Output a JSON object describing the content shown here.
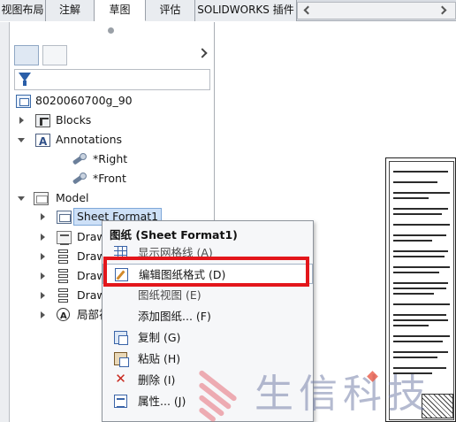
{
  "tabs": [
    {
      "label": "视图布局"
    },
    {
      "label": "注解"
    },
    {
      "label": "草图",
      "active": true
    },
    {
      "label": "评估"
    },
    {
      "label": "SOLIDWORKS 插件"
    }
  ],
  "tree": {
    "root": "8020060700g_90",
    "blocks": "Blocks",
    "annotations": "Annotations",
    "views": [
      "*Right",
      "*Front"
    ],
    "model": "Model",
    "sheet_format": "Sheet Format1",
    "drawings": [
      "Drawi",
      "Drawi",
      "Drawi",
      "Draw"
    ],
    "detail": "局部视"
  },
  "context_menu": {
    "title": "图纸 (Sheet Format1)",
    "items": [
      {
        "label": "显示网格线 (A)",
        "icon": "grid-icon"
      },
      {
        "label": "编辑图纸格式 (D)",
        "icon": "edit-sheet-format-icon",
        "highlighted": true
      },
      {
        "label": "图纸视图 (E)",
        "icon": ""
      },
      {
        "label": "添加图纸... (F)",
        "icon": ""
      },
      {
        "label": "复制 (G)",
        "icon": "copy-icon"
      },
      {
        "label": "粘贴 (H)",
        "icon": "paste-icon"
      },
      {
        "label": "删除 (I)",
        "icon": "delete-icon"
      },
      {
        "label": "属性... (J)",
        "icon": "properties-icon"
      }
    ]
  },
  "watermark": {
    "text": "生信科技"
  },
  "colors": {
    "highlight_box": "#e3161b",
    "selection": "#cde0f7",
    "accent": "#2a5ea8"
  }
}
